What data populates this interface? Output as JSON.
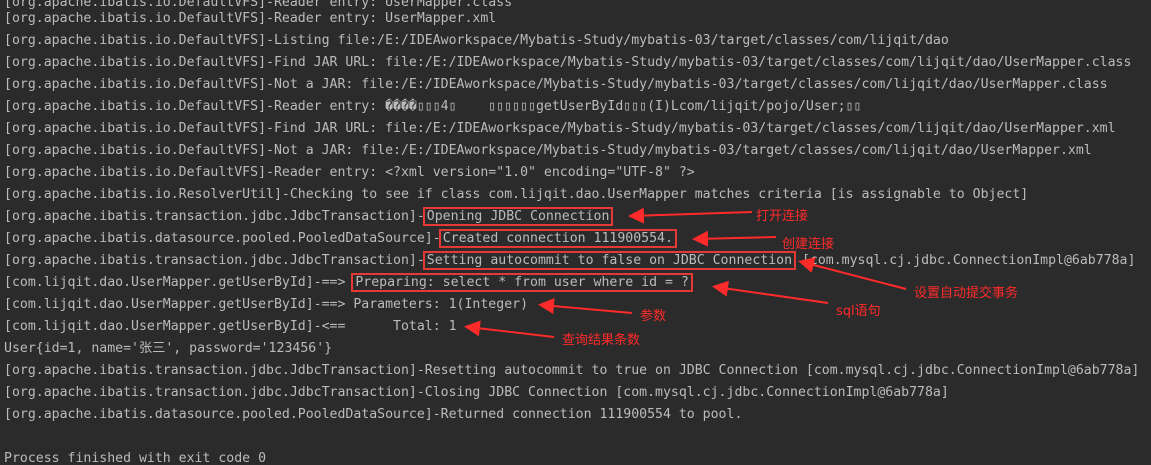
{
  "colors": {
    "background": "#2b2b2b",
    "text": "#bbbbbb",
    "annotation": "#ff2a2a",
    "highlight_box": "#e53935"
  },
  "console": {
    "lines": [
      "[org.apache.ibatis.io.DefaultVFS]-Reader entry: UserMapper.class",
      "[org.apache.ibatis.io.DefaultVFS]-Reader entry: UserMapper.xml",
      "[org.apache.ibatis.io.DefaultVFS]-Listing file:/E:/IDEAworkspace/Mybatis-Study/mybatis-03/target/classes/com/lijqit/dao",
      "[org.apache.ibatis.io.DefaultVFS]-Find JAR URL: file:/E:/IDEAworkspace/Mybatis-Study/mybatis-03/target/classes/com/lijqit/dao/UserMapper.class",
      "[org.apache.ibatis.io.DefaultVFS]-Not a JAR: file:/E:/IDEAworkspace/Mybatis-Study/mybatis-03/target/classes/com/lijqit/dao/UserMapper.class",
      "[org.apache.ibatis.io.DefaultVFS]-Reader entry: ����▯▯▯4▯    ▯▯▯▯▯▯getUserById▯▯▯(I)Lcom/lijqit/pojo/User;▯▯",
      "[org.apache.ibatis.io.DefaultVFS]-Find JAR URL: file:/E:/IDEAworkspace/Mybatis-Study/mybatis-03/target/classes/com/lijqit/dao/UserMapper.xml",
      "[org.apache.ibatis.io.DefaultVFS]-Not a JAR: file:/E:/IDEAworkspace/Mybatis-Study/mybatis-03/target/classes/com/lijqit/dao/UserMapper.xml",
      "[org.apache.ibatis.io.DefaultVFS]-Reader entry: <?xml version=\"1.0\" encoding=\"UTF-8\" ?>",
      "[org.apache.ibatis.io.ResolverUtil]-Checking to see if class com.lijqit.dao.UserMapper matches criteria [is assignable to Object]"
    ],
    "open_prefix": "[org.apache.ibatis.transaction.jdbc.JdbcTransaction]-",
    "open_text": "Opening JDBC Connection",
    "create_prefix": "[org.apache.ibatis.datasource.pooled.PooledDataSource]-",
    "create_text": "Created connection 111900554.",
    "autocommit_prefix": "[org.apache.ibatis.transaction.jdbc.JdbcTransaction]-",
    "autocommit_text": "Setting autocommit to false on JDBC Connection",
    "autocommit_suffix": " [com.mysql.cj.jdbc.ConnectionImpl@6ab778a]",
    "preparing_prefix": "[com.lijqit.dao.UserMapper.getUserById]-==> ",
    "preparing_text": "Preparing: select * from user where id = ?",
    "parameters_line": "[com.lijqit.dao.UserMapper.getUserById]-==> Parameters: 1(Integer)",
    "total_line": "[com.lijqit.dao.UserMapper.getUserById]-<==      Total: 1",
    "user_line": "User{id=1, name='张三', password='123456'}",
    "resetting_line": "[org.apache.ibatis.transaction.jdbc.JdbcTransaction]-Resetting autocommit to true on JDBC Connection [com.mysql.cj.jdbc.ConnectionImpl@6ab778a]",
    "closing_line": "[org.apache.ibatis.transaction.jdbc.JdbcTransaction]-Closing JDBC Connection [com.mysql.cj.jdbc.ConnectionImpl@6ab778a]",
    "returned_line": "[org.apache.ibatis.datasource.pooled.PooledDataSource]-Returned connection 111900554 to pool.",
    "blank_line": "",
    "exit_line": "Process finished with exit code 0"
  },
  "annotations": {
    "open": "打开连接",
    "create": "创建连接",
    "autocommit": "设置自动提交事务",
    "sql": "sql语句",
    "params": "参数",
    "total": "查询结果条数"
  }
}
